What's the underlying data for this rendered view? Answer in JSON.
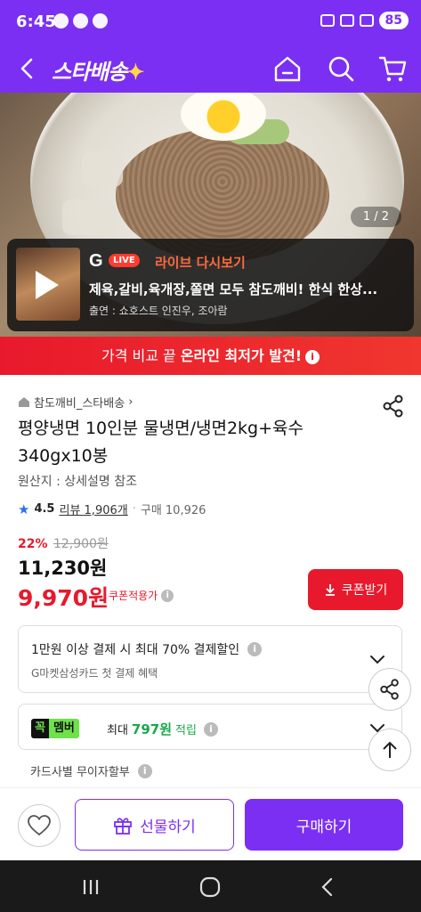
{
  "status_bar": {
    "time": "6:45",
    "battery": "85"
  },
  "header": {
    "logo": "스타배송",
    "logo_star": "✦"
  },
  "hero": {
    "page_indicator": "1 / 2"
  },
  "live": {
    "g_logo": "G",
    "badge": "LIVE",
    "title": "라이브 다시보기",
    "description": "제육,갈비,육개장,쫄면 모두 참도깨비! 한식 한상...",
    "cast": "출연 : 쇼호스트 인진우, 조아람"
  },
  "banner": {
    "text_pre": "가격 비교 끝 ",
    "text_bold": "온라인 최저가 발견!",
    "info": "i"
  },
  "product": {
    "store": "참도깨비_스타배송",
    "title": "평양냉면 10인분 물냉면/냉면2kg+육수340gx10봉",
    "origin": "원산지 : 상세설명 참조",
    "rating": "4.5",
    "reviews": "리뷰 1,906개",
    "sales_sep": "·",
    "sales": "구매 10,926",
    "discount_rate": "22%",
    "original_price": "12,900원",
    "price": "11,230원",
    "coupon_price": "9,970원",
    "coupon_label": "쿠폰적용가",
    "coupon_button": "쿠폰받기"
  },
  "benefit": {
    "card_discount": "1만원 이상 결제 시 최대  70% 결제할인",
    "card_detail": "G마켓삼성카드 첫 결제 혜택",
    "member_a": "꼭",
    "member_b": "멤버",
    "member_pre": "최대",
    "member_amount": "797원",
    "member_post": "적립",
    "installment": "카드사별 무이자할부"
  },
  "bottom": {
    "gift": "선물하기",
    "buy": "구매하기"
  },
  "colors": {
    "brand": "#7b2ff2",
    "sale": "#e8192c",
    "member": "#6fe24a"
  }
}
